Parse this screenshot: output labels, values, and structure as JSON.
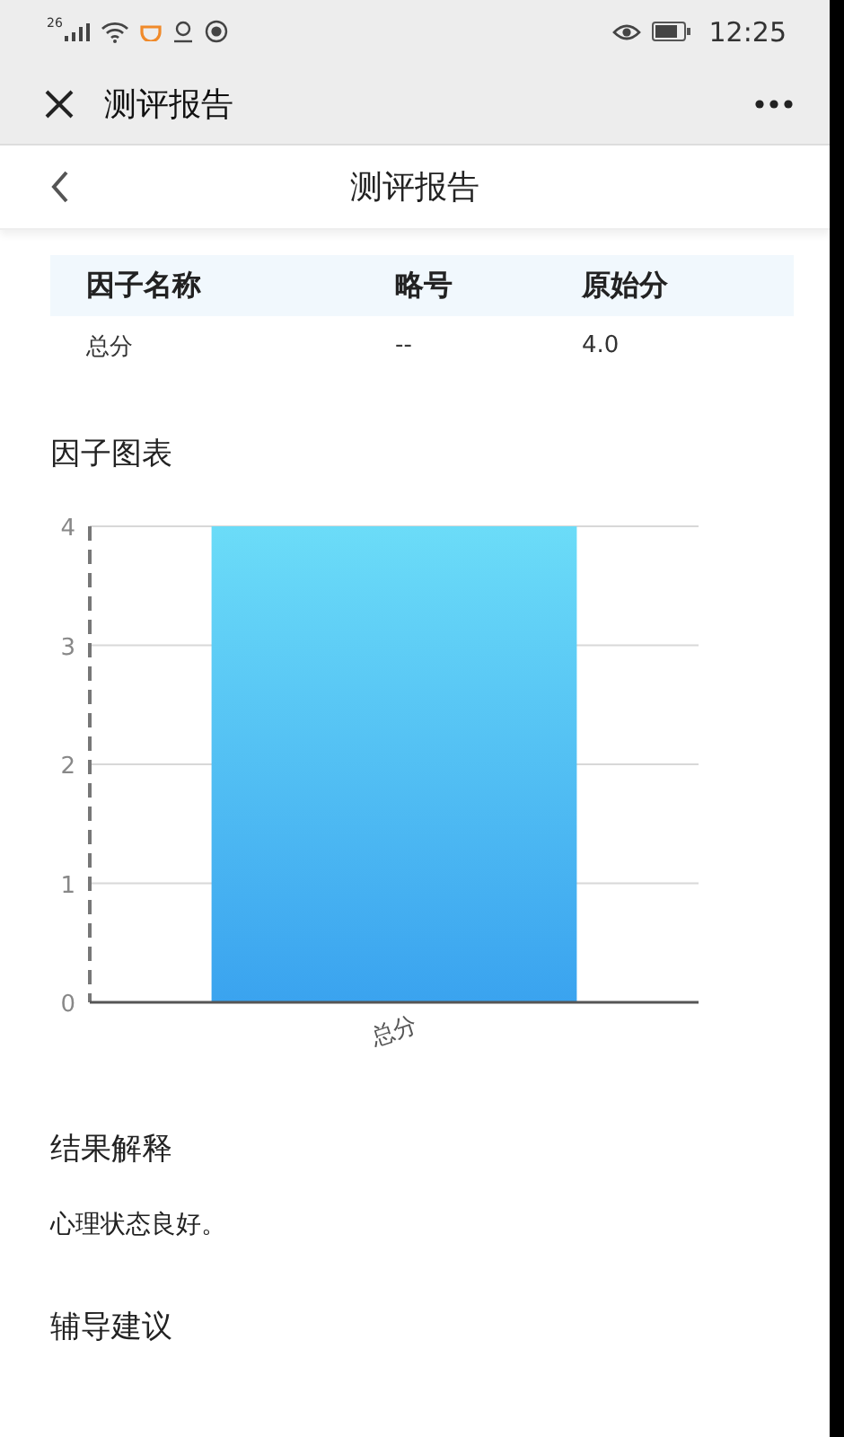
{
  "status_bar": {
    "network": "26",
    "time": "12:25"
  },
  "nav_bar": {
    "title": "测评报告"
  },
  "page_header": {
    "title": "测评报告"
  },
  "table": {
    "columns": [
      "因子名称",
      "略号",
      "原始分"
    ],
    "rows": [
      [
        "总分",
        "--",
        "4.0"
      ]
    ]
  },
  "chart_section": {
    "title": "因子图表",
    "chart_data": {
      "type": "bar",
      "categories": [
        "总分"
      ],
      "values": [
        4
      ],
      "ylim": [
        0,
        4
      ],
      "grid": true,
      "yticks": [
        0,
        1,
        2,
        3,
        4
      ]
    }
  },
  "sections": [
    {
      "title": "结果解释",
      "body": "心理状态良好。"
    },
    {
      "title": "辅导建议"
    }
  ]
}
